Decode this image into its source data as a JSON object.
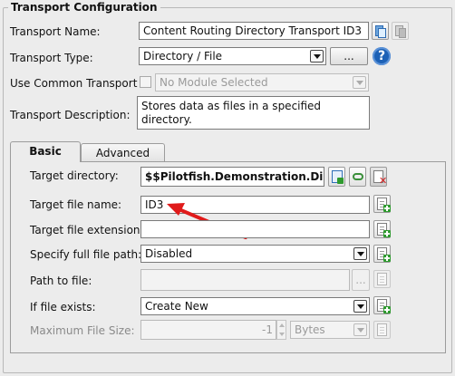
{
  "group": {
    "title": "Transport Configuration"
  },
  "transport_name": {
    "label": "Transport Name:",
    "value": "Content Routing Directory Transport ID3"
  },
  "transport_type": {
    "label": "Transport Type:",
    "value": "Directory / File",
    "button": "..."
  },
  "common_transport": {
    "label": "Use Common Transport",
    "value": "No Module Selected"
  },
  "description": {
    "label": "Transport Description:",
    "value": "Stores data as files in a specified directory."
  },
  "tabs": [
    {
      "label": "Basic",
      "active": true
    },
    {
      "label": "Advanced",
      "active": false
    }
  ],
  "fields": {
    "target_directory": {
      "label": "Target directory:",
      "value": "$$Pilotfish.Demonstration.Director"
    },
    "target_file_name": {
      "label": "Target file name:",
      "value": "ID3"
    },
    "target_file_extension": {
      "label": "Target file extension:",
      "value": ""
    },
    "full_file_path": {
      "label": "Specify full file path:",
      "value": "Disabled"
    },
    "path_to_file": {
      "label": "Path to file:",
      "value": "",
      "button": "..."
    },
    "if_file_exists": {
      "label": "If file exists:",
      "value": "Create New"
    },
    "max_file_size": {
      "label": "Maximum File Size:",
      "value": "-1",
      "unit": "Bytes"
    }
  },
  "icons": {
    "add_doc": "document-add-icon",
    "help": "help-icon",
    "copy": "copy-icon",
    "annotation": "red-arrow"
  },
  "colors": {
    "accent": "#1d61b6",
    "annotation": "#e01b1b",
    "plus": "#2e9a2e"
  }
}
